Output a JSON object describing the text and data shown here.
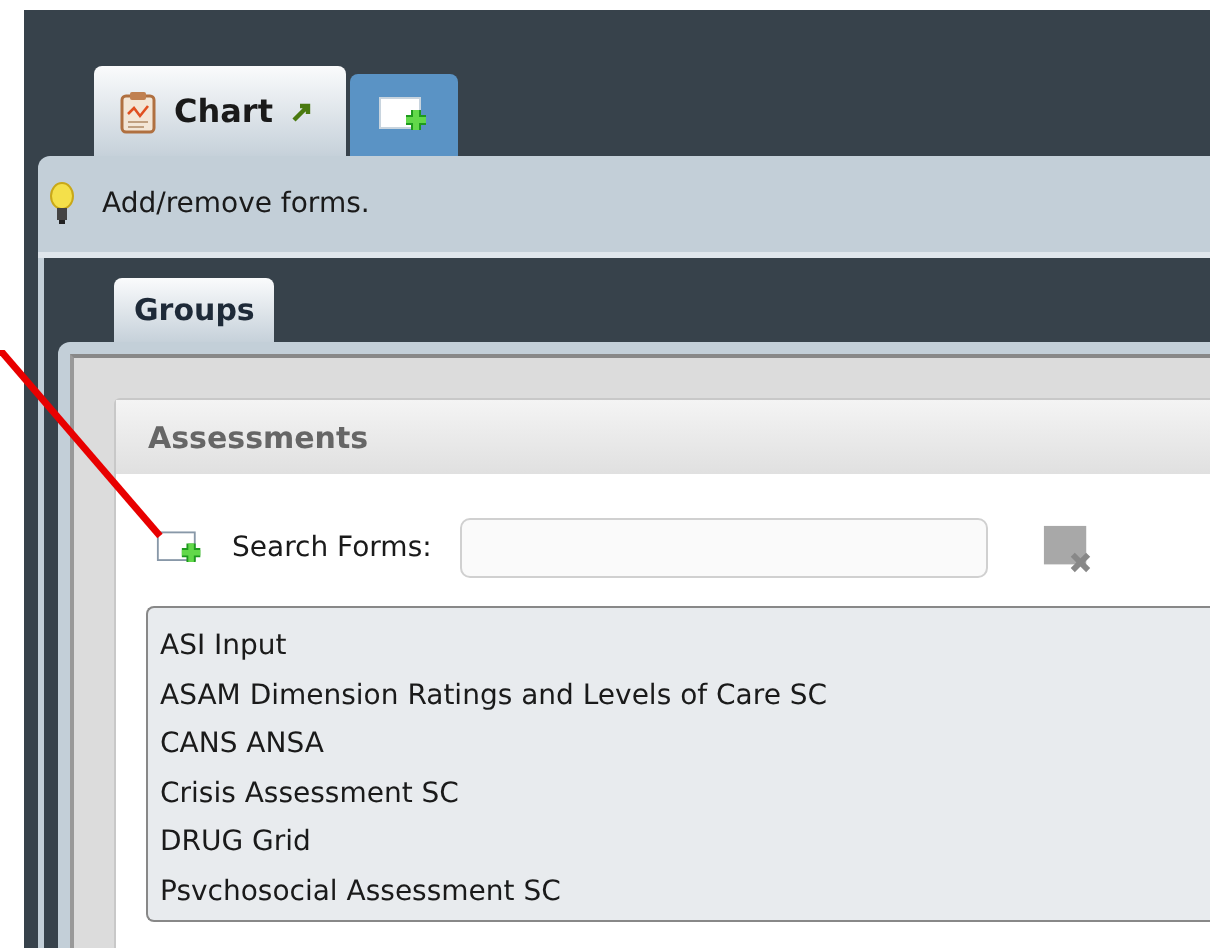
{
  "tabs": [
    {
      "kind": "chart",
      "label": "Chart",
      "selected": true
    },
    {
      "kind": "add",
      "selected": false
    }
  ],
  "hint": "Add/remove forms.",
  "subtabs": [
    {
      "label": "Groups",
      "selected": true
    }
  ],
  "panel": {
    "title": "Assessments",
    "search_label": "Search Forms:",
    "forms": [
      "ASI Input",
      "ASAM Dimension Ratings and Levels of Care SC",
      "CANS ANSA",
      "Crisis Assessment SC",
      "DRUG Grid",
      "Psvchosocial Assessment SC"
    ]
  }
}
